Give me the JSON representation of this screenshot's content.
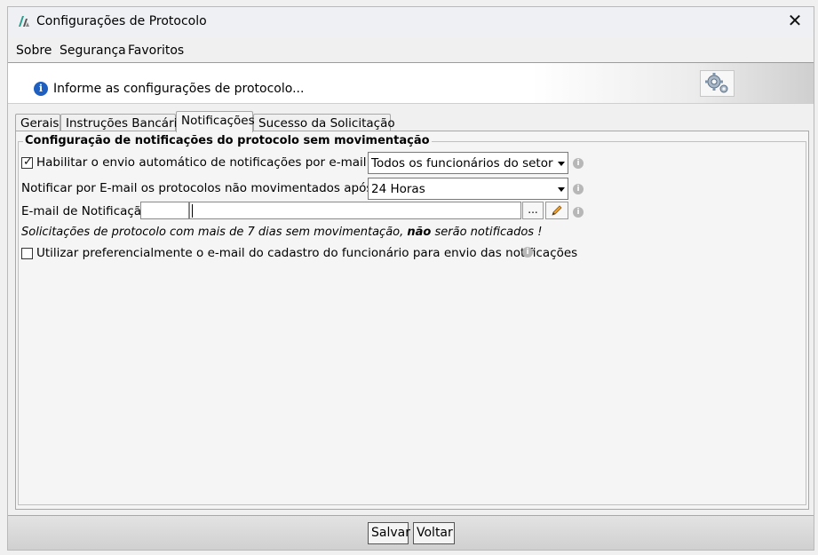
{
  "window": {
    "title": "Configurações de Protocolo",
    "close_symbol": "✕"
  },
  "menu": {
    "items": [
      {
        "label": "Sobre"
      },
      {
        "label": "Segurança"
      },
      {
        "label": "Favoritos"
      }
    ]
  },
  "banner": {
    "info_text": "Informe as configurações de protocolo...",
    "icon": "info-icon",
    "button_icon": "gear-icon"
  },
  "tabs": [
    {
      "label": "Gerais",
      "active": false
    },
    {
      "label": "Instruções Bancárias",
      "active": false
    },
    {
      "label": "Notificações",
      "active": true
    },
    {
      "label": "Sucesso da Solicitação",
      "active": false
    }
  ],
  "group": {
    "title": "Configuração de notificações do protocolo sem movimentação",
    "enable_label": "Habilitar o envio automático de notificações por e-mail para:",
    "enable_checked": true,
    "recipients_value": "Todos os funcionários do setor",
    "notify_after_label": "Notificar por E-mail os protocolos não movimentados após:",
    "notify_after_value": "24 Horas",
    "email_label": "E-mail de Notificação:",
    "email_code_value": "",
    "email_value": "",
    "browse_button": "...",
    "edit_icon": "pencil-icon",
    "warning_prefix": "Solicitações de protocolo com mais de 7 dias sem movimentação,",
    "warning_bold": "não",
    "warning_suffix": "serão notificados !",
    "prefer_label": "Utilizar preferencialmente o e-mail do cadastro do funcionário para envio das notificações",
    "prefer_checked": false,
    "help_glyph": "i"
  },
  "footer": {
    "save_label": "Salvar",
    "back_label": "Voltar"
  },
  "colors": {
    "info_blue": "#1f5fbf",
    "pencil_orange": "#f0a030"
  }
}
